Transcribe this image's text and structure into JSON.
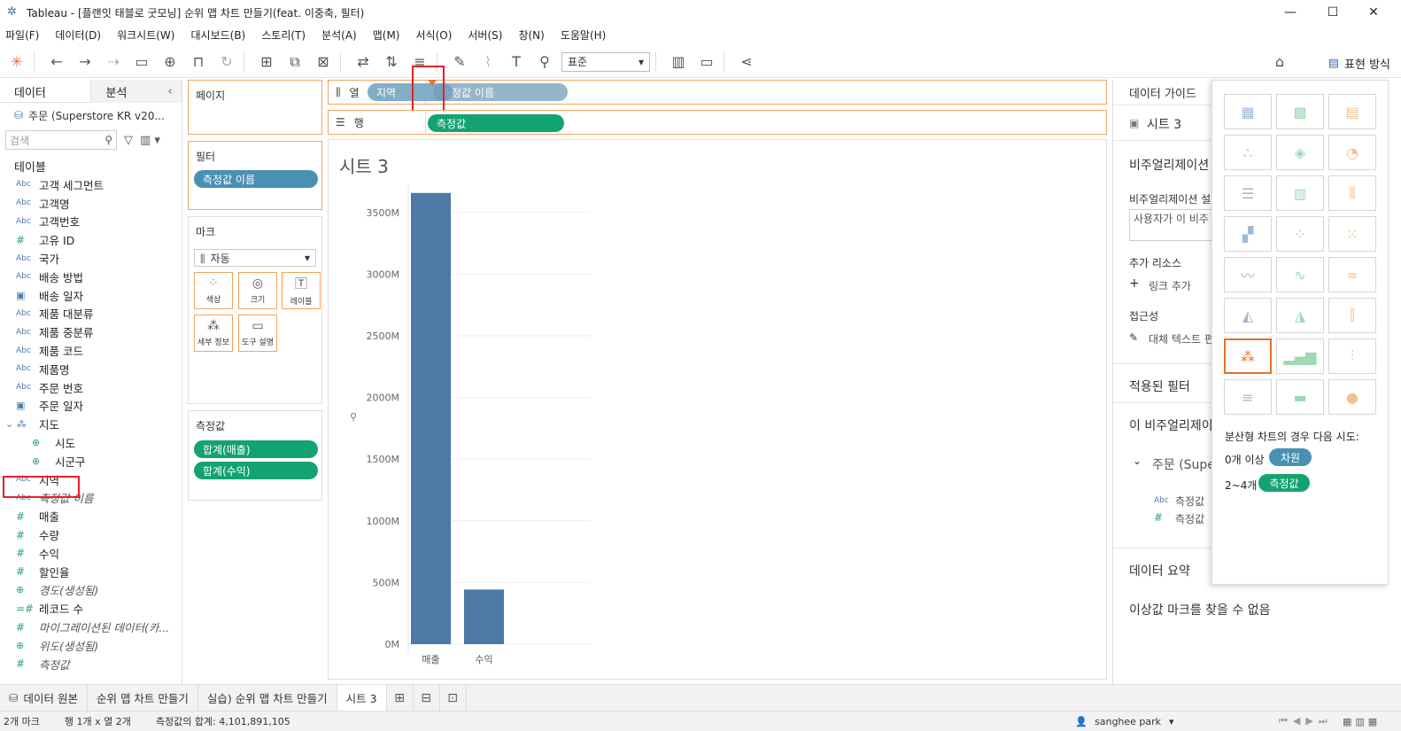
{
  "window": {
    "title": "Tableau - [플랜잇 태블로 굿모닝] 순위 맵 차트 만들기(feat. 이중축, 필터)",
    "controls": [
      "minimize-icon",
      "maximize-icon",
      "close-icon"
    ]
  },
  "menu": [
    "파일(F)",
    "데이터(D)",
    "워크시트(W)",
    "대시보드(B)",
    "스토리(T)",
    "분석(A)",
    "맵(M)",
    "서식(O)",
    "서버(S)",
    "창(N)",
    "도움말(H)"
  ],
  "toolbar": {
    "fit_select": "표준",
    "show_me_label": "표현 방식"
  },
  "data_pane": {
    "tabs": [
      "데이터",
      "분석"
    ],
    "source": "주문 (Superstore KR v20...",
    "search_placeholder": "검색",
    "tables_label": "테이블",
    "fields": [
      {
        "type": "Abc",
        "name": "고객 세그먼트"
      },
      {
        "type": "Abc",
        "name": "고객명"
      },
      {
        "type": "Abc",
        "name": "고객번호"
      },
      {
        "type": "#",
        "name": "고유 ID"
      },
      {
        "type": "Abc",
        "name": "국가"
      },
      {
        "type": "Abc",
        "name": "배송 방법"
      },
      {
        "type": "date",
        "name": "배송 일자"
      },
      {
        "type": "Abc",
        "name": "제품 대분류"
      },
      {
        "type": "Abc",
        "name": "제품 중분류"
      },
      {
        "type": "Abc",
        "name": "제품 코드"
      },
      {
        "type": "Abc",
        "name": "제품명"
      },
      {
        "type": "Abc",
        "name": "주문 번호"
      },
      {
        "type": "date",
        "name": "주문 일자"
      },
      {
        "type": "hier",
        "name": "지도"
      },
      {
        "type": "geo",
        "name": "시도"
      },
      {
        "type": "geo",
        "name": "시군구"
      },
      {
        "type": "Abc",
        "name": "지역"
      },
      {
        "type": "Abc",
        "name": "측정값 이름"
      },
      {
        "type": "#",
        "name": "매출"
      },
      {
        "type": "#",
        "name": "수량"
      },
      {
        "type": "#",
        "name": "수익"
      },
      {
        "type": "#",
        "name": "할인율"
      },
      {
        "type": "geo",
        "name": "경도(생성됨)"
      },
      {
        "type": "=#",
        "name": "레코드 수"
      },
      {
        "type": "#",
        "name": "마이그레이션된 데이터(카..."
      },
      {
        "type": "geo",
        "name": "위도(생성됨)"
      },
      {
        "type": "#",
        "name": "측정값"
      }
    ]
  },
  "shelves": {
    "pages_label": "페이지",
    "filters_label": "필터",
    "filter_pill": "측정값 이름",
    "marks_label": "마크",
    "marks_type": "자동",
    "mark_buttons": [
      "색상",
      "크기",
      "레이블",
      "세부 정보",
      "도구 설명"
    ],
    "measure_values_label": "측정값",
    "measure_pills": [
      "합계(매출)",
      "합계(수익)"
    ],
    "columns_label": "열",
    "columns_pill_dragging": "지역",
    "columns_pill": "측정값 이름",
    "rows_label": "행",
    "rows_pill": "측정값"
  },
  "view": {
    "sheet_title": "시트 3"
  },
  "chart_data": {
    "type": "bar",
    "categories": [
      "매출",
      "수익"
    ],
    "values": [
      3658000000,
      443000000
    ],
    "yticks": [
      "0M",
      "500M",
      "1000M",
      "1500M",
      "2000M",
      "2500M",
      "3000M",
      "3500M"
    ],
    "ylim": [
      0,
      3800000000
    ],
    "bar_color": "#4e79a7",
    "grid": true
  },
  "data_guide": {
    "header": "데이터 가이드",
    "sheet": "시트 3",
    "viz_label": "비주얼리제이션",
    "viz_desc_label": "비주얼리제이션 설",
    "desc_placeholder": "사용자가 이 비주 되는 설명을 입력",
    "resources_label": "추가 리소스",
    "add_link": "링크 추가",
    "accessibility_label": "접근성",
    "alt_text": "대체 텍스트 편",
    "applied_filters": "적용된 필터",
    "this_viz": "이 비주얼리제이",
    "source": "주문 (Supe",
    "field1": "측정값",
    "field2": "측정값",
    "summary": "데이터 요약",
    "outlier": "이상값 마크를 찾을 수 없음"
  },
  "show_me": {
    "hint": "분산형 차트의 경우 다음 시도:",
    "req1_label": "0개 이상",
    "req1_pill": "차원",
    "req2_label": "2~4개",
    "req2_pill": "측정값"
  },
  "sheet_tabs": [
    "데이터 원본",
    "순위 맵 차트 만들기",
    "실습) 순위 맵 차트 만들기",
    "시트 3"
  ],
  "status": {
    "marks": "2개 마크",
    "rows_cols": "행 1개 x 열 2개",
    "sum": "측정값의 합계: 4,101,891,105",
    "user": "sanghee park"
  }
}
